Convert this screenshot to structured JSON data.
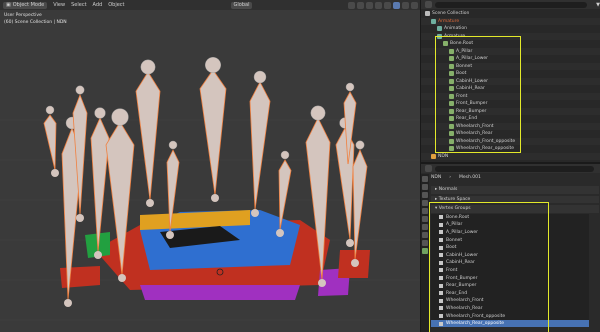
{
  "header": {
    "mode": "Object Mode",
    "menu": [
      "View",
      "Select",
      "Add",
      "Object"
    ],
    "transform": "Global"
  },
  "viewport": {
    "info_line1": "User Perspective",
    "info_line2": "(60) Scene Collection | NDN"
  },
  "outliner": {
    "rows": [
      {
        "label": "Scene Collection",
        "indent": 0,
        "kind": "scene"
      },
      {
        "label": "Armature",
        "indent": 1,
        "kind": "arm",
        "accent": "#e06a3a"
      },
      {
        "label": "Animation",
        "indent": 2,
        "kind": "anim"
      },
      {
        "label": "Armature",
        "indent": 2,
        "kind": "arm"
      },
      {
        "label": "Bone.Root",
        "indent": 3,
        "kind": "bone"
      },
      {
        "label": "A_Pillar",
        "indent": 4,
        "kind": "bone"
      },
      {
        "label": "A_Pillar_Lower",
        "indent": 4,
        "kind": "bone"
      },
      {
        "label": "Bonnet",
        "indent": 4,
        "kind": "bone"
      },
      {
        "label": "Boot",
        "indent": 4,
        "kind": "bone"
      },
      {
        "label": "CabinH_Lower",
        "indent": 4,
        "kind": "bone"
      },
      {
        "label": "CabinH_Rear",
        "indent": 4,
        "kind": "bone"
      },
      {
        "label": "Front",
        "indent": 4,
        "kind": "bone"
      },
      {
        "label": "Front_Bumper",
        "indent": 4,
        "kind": "bone"
      },
      {
        "label": "Rear_Bumper",
        "indent": 4,
        "kind": "bone"
      },
      {
        "label": "Rear_End",
        "indent": 4,
        "kind": "bone"
      },
      {
        "label": "Wheelarch_Front",
        "indent": 4,
        "kind": "bone"
      },
      {
        "label": "Wheelarch_Rear",
        "indent": 4,
        "kind": "bone"
      },
      {
        "label": "Wheelarch_Front_opposite",
        "indent": 4,
        "kind": "bone"
      },
      {
        "label": "Wheelarch_Rear_opposite",
        "indent": 4,
        "kind": "bone"
      },
      {
        "label": "NDN",
        "indent": 1,
        "kind": "mesh"
      }
    ]
  },
  "properties": {
    "object_name": "NDN",
    "mesh_name": "Mesh.001",
    "sections": [
      "Normals",
      "Texture Space"
    ],
    "vertex_groups_title": "Vertex Groups",
    "vertex_groups": [
      "Bone.Root",
      "A_Pillar",
      "A_Pillar_Lower",
      "Bonnet",
      "Boot",
      "CabinH_Lower",
      "CabinH_Rear",
      "Front",
      "Front_Bumper",
      "Rear_Bumper",
      "Rear_End",
      "Wheelarch_Front",
      "Wheelarch_Rear",
      "Wheelarch_Front_opposite",
      "Wheelarch_Rear_opposite"
    ],
    "selected_index": 14
  },
  "colors": {
    "highlight": "#e3e92a",
    "bone_fill": "#d4c5be",
    "bone_outline": "#f08040",
    "selection": "#4772b3"
  }
}
